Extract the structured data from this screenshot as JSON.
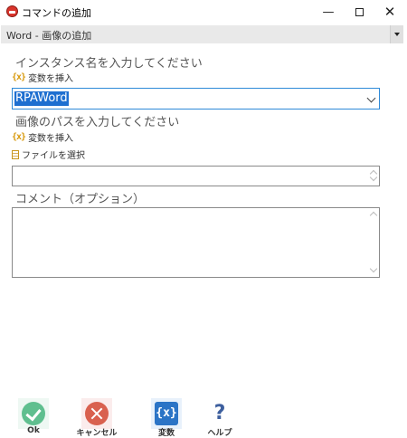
{
  "window": {
    "title": "コマンドの追加",
    "minimize": "—",
    "close": "✕"
  },
  "command_select": {
    "value": "Word - 画像の追加"
  },
  "instance": {
    "label": "インスタンス名を入力してください",
    "insert_var": "変数を挿入",
    "var_icon": "{x}",
    "value": "RPAWord"
  },
  "image_path": {
    "label": "画像のパスを入力してください",
    "insert_var": "変数を挿入",
    "var_icon": "{x}",
    "select_file": "ファイルを選択",
    "value": ""
  },
  "comment": {
    "label": "コメント（オプション）",
    "value": ""
  },
  "buttons": {
    "ok": "Ok",
    "cancel": "キャンセル",
    "variables": "変数",
    "variables_icon": "{x}",
    "help": "ヘルプ",
    "help_icon": "?"
  }
}
